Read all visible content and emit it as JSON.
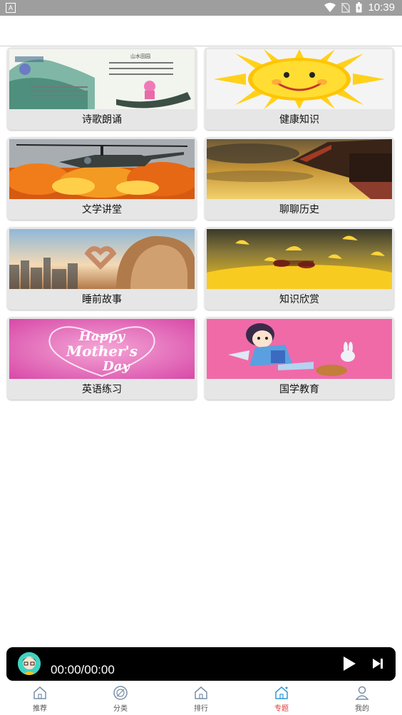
{
  "status_bar": {
    "time": "10:39",
    "app_icon_letter": "A"
  },
  "topics": [
    {
      "title": "诗歌朗诵",
      "image": "poetry-landscape-image"
    },
    {
      "title": "健康知识",
      "image": "smiling-sun-image"
    },
    {
      "title": "文学讲堂",
      "image": "helicopter-explosion-image"
    },
    {
      "title": "聊聊历史",
      "image": "pagoda-roof-sunset-image"
    },
    {
      "title": "睡前故事",
      "image": "heart-hands-city-image"
    },
    {
      "title": "知识欣赏",
      "image": "ginkgo-leaves-image"
    },
    {
      "title": "英语练习",
      "image": "happy-mothers-day-image"
    },
    {
      "title": "国学教育",
      "image": "cartoon-girl-rabbit-image"
    }
  ],
  "image_text": {
    "mothers_day_line1": "Happy",
    "mothers_day_line2": "Mother's",
    "mothers_day_line3": "Day",
    "poem_heading": "山水田园"
  },
  "player": {
    "time": "00:00/00:00"
  },
  "tabs": [
    {
      "label": "推荐",
      "icon": "home-icon",
      "active": false
    },
    {
      "label": "分类",
      "icon": "category-icon",
      "active": false
    },
    {
      "label": "排行",
      "icon": "ranking-icon",
      "active": false
    },
    {
      "label": "专题",
      "icon": "topic-icon",
      "active": true
    },
    {
      "label": "我的",
      "icon": "profile-icon",
      "active": false
    }
  ],
  "colors": {
    "status_bar": "#9e9e9e",
    "active_tab": "#e53935",
    "player_bg": "#000000"
  }
}
